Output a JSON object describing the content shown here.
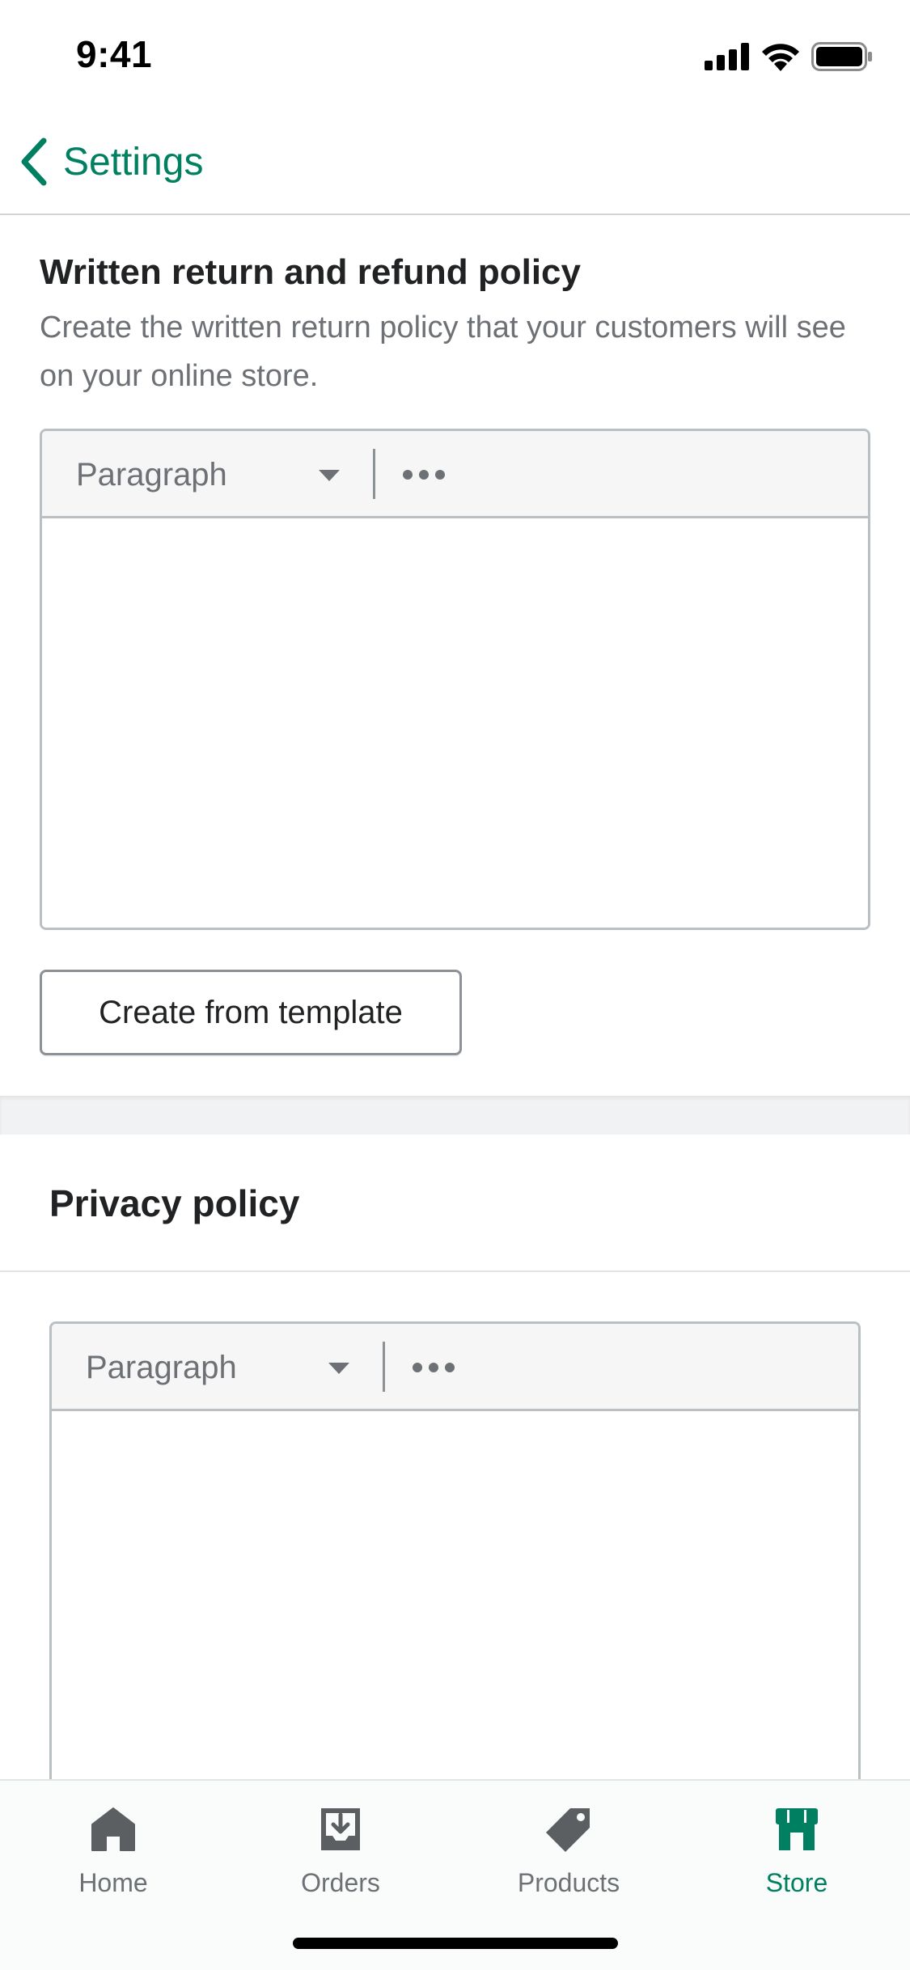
{
  "status_bar": {
    "time": "9:41"
  },
  "nav": {
    "back_label": "Settings"
  },
  "refund_policy": {
    "title": "Written return and refund policy",
    "description": "Create the written return policy that your customers will see on your online store.",
    "editor": {
      "format_value": "Paragraph",
      "content": ""
    },
    "template_button_label": "Create from template"
  },
  "privacy_policy": {
    "title": "Privacy policy",
    "editor": {
      "format_value": "Paragraph",
      "content": ""
    }
  },
  "tab_bar": {
    "tabs": [
      {
        "label": "Home",
        "icon": "home-icon",
        "active": false
      },
      {
        "label": "Orders",
        "icon": "orders-icon",
        "active": false
      },
      {
        "label": "Products",
        "icon": "tag-icon",
        "active": false
      },
      {
        "label": "Store",
        "icon": "store-icon",
        "active": true
      }
    ]
  },
  "colors": {
    "accent": "#008060",
    "text": "#202223",
    "subdued": "#6d7175",
    "border": "#babfc3",
    "toolbar_bg": "#f6f6f7",
    "section_gap": "#f1f2f3",
    "tab_inactive": "#5c5f62"
  }
}
